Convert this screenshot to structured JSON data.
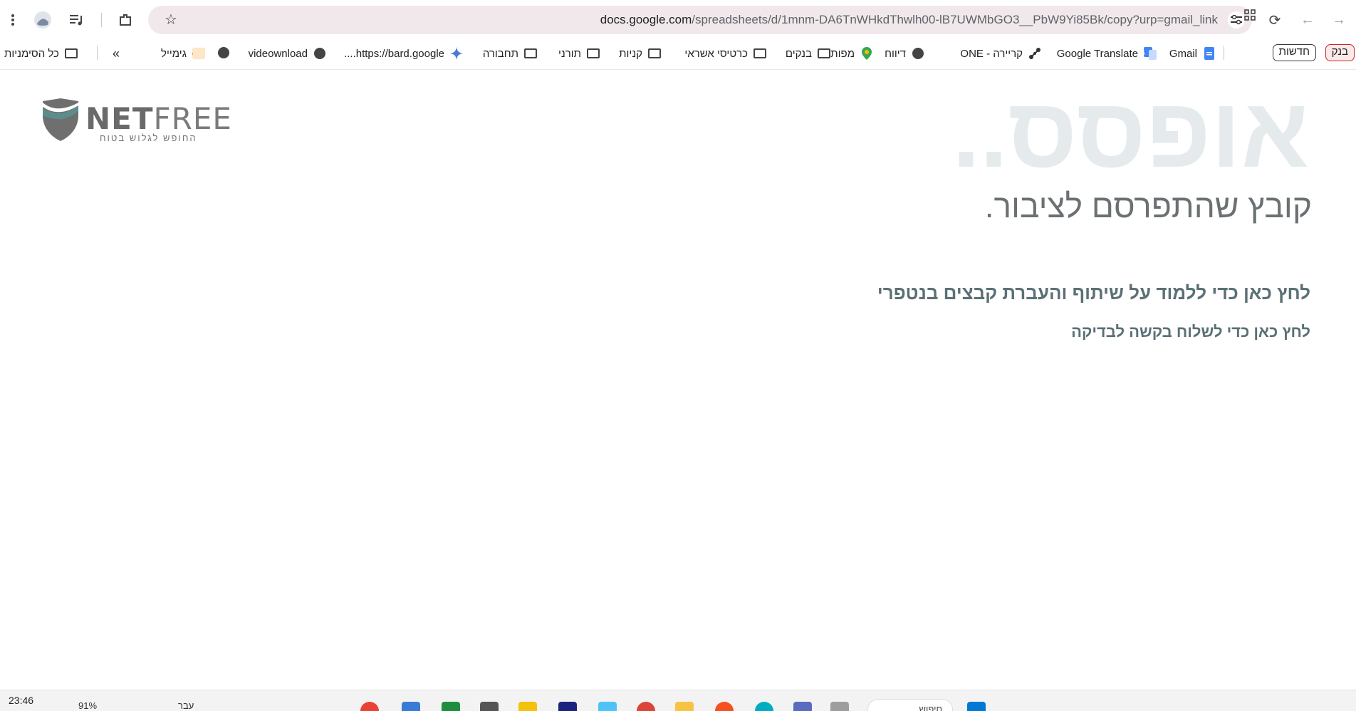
{
  "browser": {
    "url_host": "docs.google.com",
    "url_path": "/spreadsheets/d/1mnm-DA6TnWHkdThwlh00-lB7UWMbGO3__PbW9Yi85Bk/copy?urp=gmail_link"
  },
  "bookmarks": {
    "items": [
      {
        "label": "בנק"
      },
      {
        "label": "חדשות"
      },
      {
        "label": "Gmail"
      },
      {
        "label": "Google Translate"
      },
      {
        "label": "קריירה - ONE"
      },
      {
        "label": "דיווח"
      },
      {
        "label": "מפות"
      },
      {
        "label": "בנקים"
      },
      {
        "label": "כרטיסי אשראי"
      },
      {
        "label": "קניות"
      },
      {
        "label": "תורני"
      },
      {
        "label": "תחבורה"
      },
      {
        "label": "https://bard.google...."
      },
      {
        "label": "videownload"
      },
      {
        "label": "גימייל"
      },
      {
        "label": "»"
      },
      {
        "label": "כל הסימניות"
      }
    ]
  },
  "page": {
    "logo_net": "NET",
    "logo_free": "FREE",
    "logo_tagline": "החופש לגלוש בטוח",
    "heading": "אופסס..",
    "subtitle": "קובץ שהתפרסם לציבור.",
    "link_learn": "לחץ כאן כדי ללמוד על שיתוף והעברת קבצים בנטפרי",
    "link_request": "לחץ כאן כדי לשלוח בקשה לבדיקה"
  },
  "taskbar": {
    "clock": "23:46",
    "battery": "91%",
    "language": "עבר",
    "search_placeholder": "חיפוש"
  },
  "colors": {
    "omnibox_bg": "#f1e8eb",
    "heading_color": "#e5ebec",
    "link_color": "#5b7076",
    "subtitle_color": "#6b7173"
  }
}
